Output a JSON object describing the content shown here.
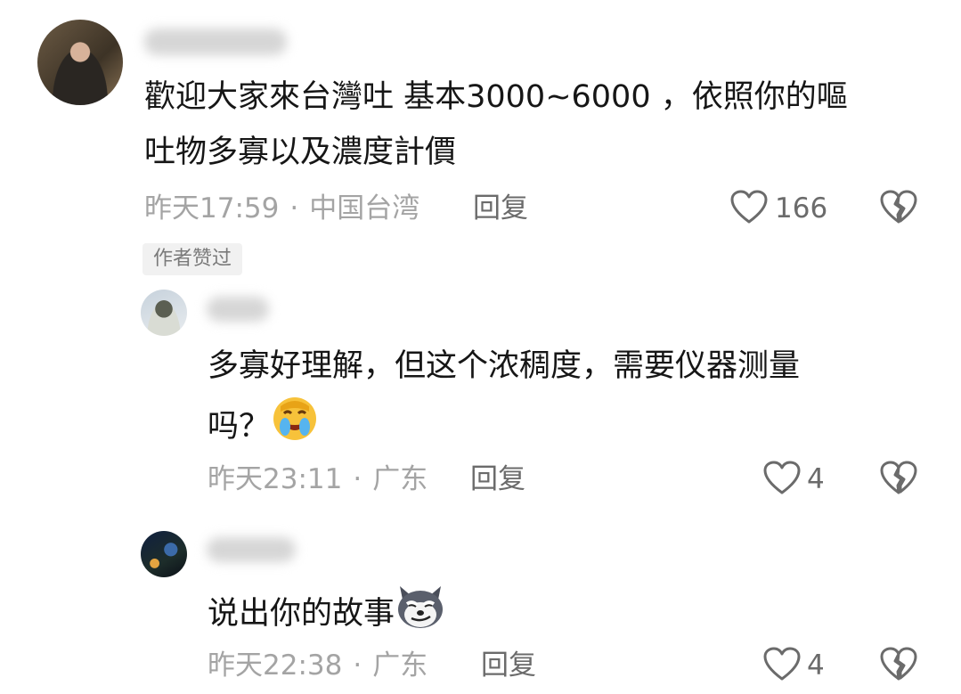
{
  "comments": [
    {
      "text_line1": "歡迎大家來台灣吐 基本3000~6000 ，依照你的嘔",
      "text_line2": "吐物多寡以及濃度計價",
      "time": "昨天17:59",
      "location": "中国台湾",
      "reply_label": "回复",
      "likes": "166",
      "badge": "作者赞过"
    },
    {
      "text_line1": "多寡好理解，但这个浓稠度，需要仪器测量",
      "text_line2": "吗？",
      "emoji": "laughing-crying-emoji",
      "time": "昨天23:11",
      "location": "广东",
      "reply_label": "回复",
      "likes": "4"
    },
    {
      "text_line1": "说出你的故事",
      "emoji": "smirking-husky-emoji",
      "time": "昨天22:38",
      "location": "广东",
      "reply_label": "回复",
      "likes": "4"
    }
  ],
  "separator": "·",
  "icons": {
    "like": "heart-outline-icon",
    "dislike": "broken-heart-icon"
  },
  "colors": {
    "text": "#161616",
    "meta": "#a4a4a4",
    "icon": "#6b6b6b"
  }
}
